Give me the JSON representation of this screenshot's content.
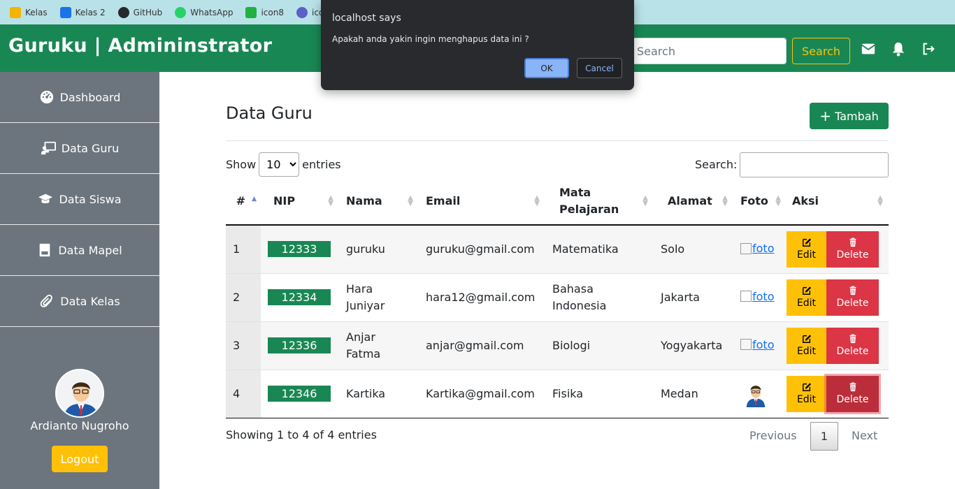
{
  "bookmarks": [
    {
      "label": "Kelas",
      "icon": "classroom-icon",
      "color": "#f4b400"
    },
    {
      "label": "Kelas 2",
      "icon": "classroom-icon",
      "color": "#1a73e8"
    },
    {
      "label": "GitHub",
      "icon": "github-icon",
      "color": "#24292e"
    },
    {
      "label": "WhatsApp",
      "icon": "whatsapp-icon",
      "color": "#25d366"
    },
    {
      "label": "icon8",
      "icon": "icons8-icon",
      "color": "#1fb141"
    },
    {
      "label": "icon sc",
      "icon": "search-circle-icon",
      "color": "#5b5fc7"
    }
  ],
  "header": {
    "brand": "Guruku | Admininstrator",
    "search_placeholder": "Search",
    "search_button": "Search"
  },
  "sidebar": {
    "items": [
      {
        "label": "Dashboard",
        "icon": "dashboard-icon"
      },
      {
        "label": "Data Guru",
        "icon": "teacher-icon"
      },
      {
        "label": "Data Siswa",
        "icon": "graduation-cap-icon"
      },
      {
        "label": "Data Mapel",
        "icon": "book-icon"
      },
      {
        "label": "Data Kelas",
        "icon": "paperclip-icon"
      }
    ],
    "user_name": "Ardianto Nugroho",
    "logout_label": "Logout"
  },
  "main": {
    "title": "Data Guru",
    "add_button": "Tambah",
    "show_label": "Show",
    "entries_label": "entries",
    "page_size": "10",
    "search_label": "Search:",
    "columns": [
      "#",
      "NIP",
      "Nama",
      "Email",
      "Mata Pelajaran",
      "Alamat",
      "Foto",
      "Aksi"
    ],
    "rows": [
      {
        "no": "1",
        "nip": "12333",
        "nama": "guruku",
        "email": "guruku@gmail.com",
        "mapel": "Matematika",
        "alamat": "Solo",
        "foto": "foto"
      },
      {
        "no": "2",
        "nip": "12334",
        "nama": "Hara Juniyar",
        "email": "hara12@gmail.com",
        "mapel": "Bahasa Indonesia",
        "alamat": "Jakarta",
        "foto": "foto"
      },
      {
        "no": "3",
        "nip": "12336",
        "nama": "Anjar Fatma",
        "email": "anjar@gmail.com",
        "mapel": "Biologi",
        "alamat": "Yogyakarta",
        "foto": "foto"
      },
      {
        "no": "4",
        "nip": "12346",
        "nama": "Kartika",
        "email": "Kartika@gmail.com",
        "mapel": "Fisika",
        "alamat": "Medan",
        "foto": ""
      }
    ],
    "edit_label": "Edit",
    "delete_label": "Delete",
    "info": "Showing 1 to 4 of 4 entries",
    "pagination": {
      "previous": "Previous",
      "current": "1",
      "next": "Next"
    }
  },
  "dialog": {
    "title": "localhost says",
    "message": "Apakah anda yakin ingin menghapus data ini ?",
    "ok": "OK",
    "cancel": "Cancel"
  },
  "colors": {
    "primary": "#198754",
    "warning": "#ffc107",
    "danger": "#dc3545",
    "sidebar": "#6c757d"
  }
}
